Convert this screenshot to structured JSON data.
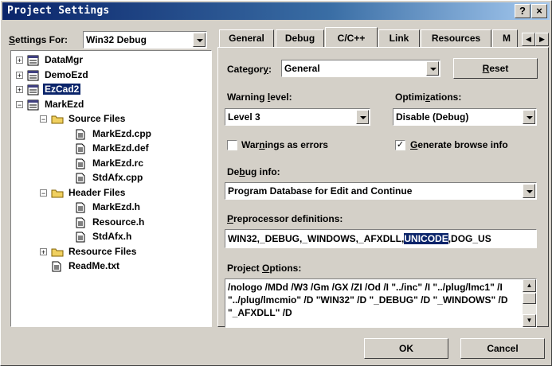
{
  "window": {
    "title": "Project Settings",
    "help_btn": "?",
    "close_btn": "×"
  },
  "settings_for": {
    "label": "Settings For:",
    "value": "Win32 Debug"
  },
  "tree": [
    {
      "label": "DataMgr",
      "sign": "+"
    },
    {
      "label": "DemoEzd",
      "sign": "+"
    },
    {
      "label": "EzCad2",
      "sign": "+",
      "selected": true
    },
    {
      "label": "MarkEzd",
      "sign": "−"
    },
    {
      "label": "Source Files",
      "sign": "−"
    },
    {
      "label": "MarkEzd.cpp"
    },
    {
      "label": "MarkEzd.def"
    },
    {
      "label": "MarkEzd.rc"
    },
    {
      "label": "StdAfx.cpp"
    },
    {
      "label": "Header Files",
      "sign": "−"
    },
    {
      "label": "MarkEzd.h"
    },
    {
      "label": "Resource.h"
    },
    {
      "label": "StdAfx.h"
    },
    {
      "label": "Resource Files",
      "sign": "+"
    },
    {
      "label": "ReadMe.txt"
    }
  ],
  "tabs": [
    "General",
    "Debug",
    "C/C++",
    "Link",
    "Resources",
    "M"
  ],
  "category": {
    "label": "Category:",
    "value": "General",
    "reset": "Reset"
  },
  "warning_level": {
    "label": "Warning level:",
    "value": "Level 3"
  },
  "optimizations": {
    "label": "Optimizations:",
    "value": "Disable (Debug)"
  },
  "warnings_as_errors": {
    "label": "Warnings as errors",
    "checked": false
  },
  "browse_info": {
    "label": "Generate browse info",
    "checked": true
  },
  "debug_info": {
    "label": "Debug info:",
    "value": "Program Database for Edit and Continue"
  },
  "preprocessor": {
    "label": "Preprocessor definitions:",
    "before": "WIN32,_DEBUG,_WINDOWS,_AFXDLL,",
    "highlight": "UNICODE",
    "after": ",DOG_US"
  },
  "project_options": {
    "label": "Project Options:",
    "text": "/nologo /MDd /W3 /Gm /GX /ZI /Od /I \"../inc\" /I \"../plug/lmc1\" /I \"../plug/lmcmio\" /D \"WIN32\" /D \"_DEBUG\" /D \"_WINDOWS\" /D \"_AFXDLL\" /D"
  },
  "buttons": {
    "ok": "OK",
    "cancel": "Cancel"
  },
  "colors": {
    "title_start": "#0a246a",
    "title_end": "#a6caf0",
    "selection": "#0a246a",
    "face": "#d4d0c8"
  }
}
